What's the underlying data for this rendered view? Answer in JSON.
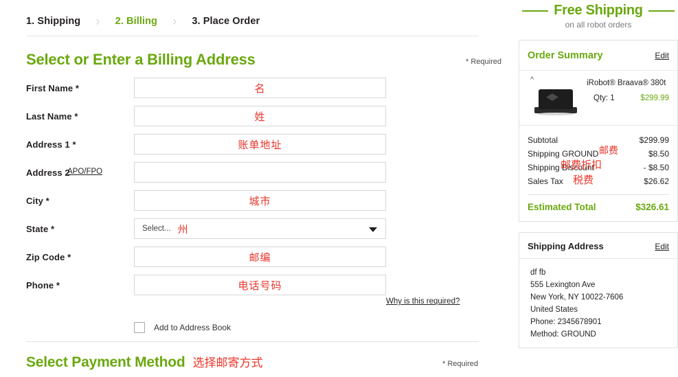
{
  "breadcrumb": {
    "separator": "›",
    "steps": [
      {
        "label": "1. Shipping",
        "active": false
      },
      {
        "label": "2. Billing",
        "active": true
      },
      {
        "label": "3. Place Order",
        "active": false
      }
    ]
  },
  "billing": {
    "title": "Select or Enter a Billing Address",
    "required_note": "* Required",
    "apofpo_link": "APO/FPO",
    "why_required_link": "Why is this required?",
    "fields": [
      {
        "label": "First Name *",
        "annotation": "名",
        "type": "text"
      },
      {
        "label": "Last Name *",
        "annotation": "姓",
        "type": "text"
      },
      {
        "label": "Address 1 *",
        "annotation": "账单地址",
        "type": "text"
      },
      {
        "label": "Address 2",
        "annotation": "",
        "type": "text"
      },
      {
        "label": "City *",
        "annotation": "城市",
        "type": "text"
      },
      {
        "label": "State *",
        "annotation": "州",
        "type": "select",
        "selected": "Select..."
      },
      {
        "label": "Zip Code *",
        "annotation": "邮编",
        "type": "text"
      },
      {
        "label": "Phone *",
        "annotation": "电话号码",
        "type": "text"
      }
    ],
    "checkbox": {
      "label": "Add to Address Book",
      "checked": false
    }
  },
  "payment": {
    "title": "Select Payment Method",
    "annotation": "选择邮寄方式",
    "required_note": "* Required"
  },
  "promo": {
    "headline": "Free Shipping",
    "subhead": "on all robot orders"
  },
  "order_summary": {
    "title": "Order Summary",
    "edit_label": "Edit",
    "collapse_icon": "^",
    "item": {
      "name": "iRobot® Braava® 380t",
      "qty_label": "Qty: 1",
      "price": "$299.99"
    },
    "totals": [
      {
        "label": "Subtotal",
        "value": "$299.99"
      },
      {
        "label": "Shipping GROUND",
        "value": "$8.50"
      },
      {
        "label": "Shipping Discount",
        "value": "- $8.50"
      },
      {
        "label": "Sales Tax",
        "value": "$26.62"
      }
    ],
    "annotations": {
      "shipping": "邮费",
      "discount": "邮费折扣",
      "tax": "税费"
    },
    "estimated_total": {
      "label": "Estimated Total",
      "value": "$326.61"
    }
  },
  "shipping_address": {
    "title": "Shipping Address",
    "edit_label": "Edit",
    "lines": [
      "df fb",
      "555 Lexington Ave",
      "New York, NY 10022-7606",
      "United States",
      "Phone: 2345678901",
      "Method: GROUND"
    ]
  },
  "colors": {
    "brand_green": "#6aa80f",
    "annotation_red": "#e8352a",
    "text": "#231f20",
    "border": "#e0e0e0"
  }
}
